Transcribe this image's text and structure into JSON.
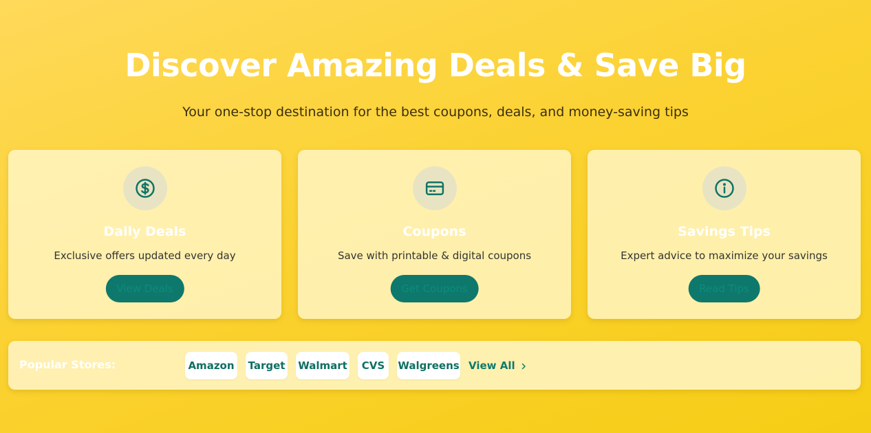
{
  "hero": {
    "title": "Discover Amazing Deals & Save Big",
    "subtitle": "Your one-stop destination for the best coupons, deals, and money-saving tips"
  },
  "cards": [
    {
      "icon": "dollar-circle-icon",
      "title": "Daily Deals",
      "description": "Exclusive offers updated every day",
      "button": "View Deals"
    },
    {
      "icon": "credit-card-icon",
      "title": "Coupons",
      "description": "Save with printable & digital coupons",
      "button": "Get Coupons"
    },
    {
      "icon": "info-circle-icon",
      "title": "Savings Tips",
      "description": "Expert advice to maximize your savings",
      "button": "Read Tips"
    }
  ],
  "stores": {
    "label": "Popular Stores:",
    "items": [
      "Amazon",
      "Target",
      "Walmart",
      "CVS",
      "Walgreens"
    ],
    "view_all": "View All"
  },
  "colors": {
    "background": "#f9d22a",
    "accent": "#0e786c",
    "card": "#fdf2c4"
  }
}
